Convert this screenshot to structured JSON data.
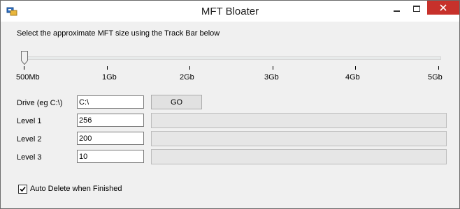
{
  "window": {
    "title": "MFT Bloater",
    "colors": {
      "close_button": "#c7312b",
      "titlebar": "#ffffff",
      "client": "#f0f0f0"
    }
  },
  "instruction": "Select the approximate MFT size using the Track Bar below",
  "trackbar": {
    "labels": [
      "500Mb",
      "1Gb",
      "2Gb",
      "3Gb",
      "4Gb",
      "5Gb"
    ],
    "selected_index": 0
  },
  "drive": {
    "label": "Drive (eg C:\\)",
    "value": "C:\\"
  },
  "go_label": "GO",
  "levels": [
    {
      "label": "Level 1",
      "value": "256",
      "progress": 0
    },
    {
      "label": "Level 2",
      "value": "200",
      "progress": 0
    },
    {
      "label": "Level 3",
      "value": "10",
      "progress": 0
    }
  ],
  "auto_delete": {
    "label": "Auto Delete when Finished",
    "checked": true
  }
}
